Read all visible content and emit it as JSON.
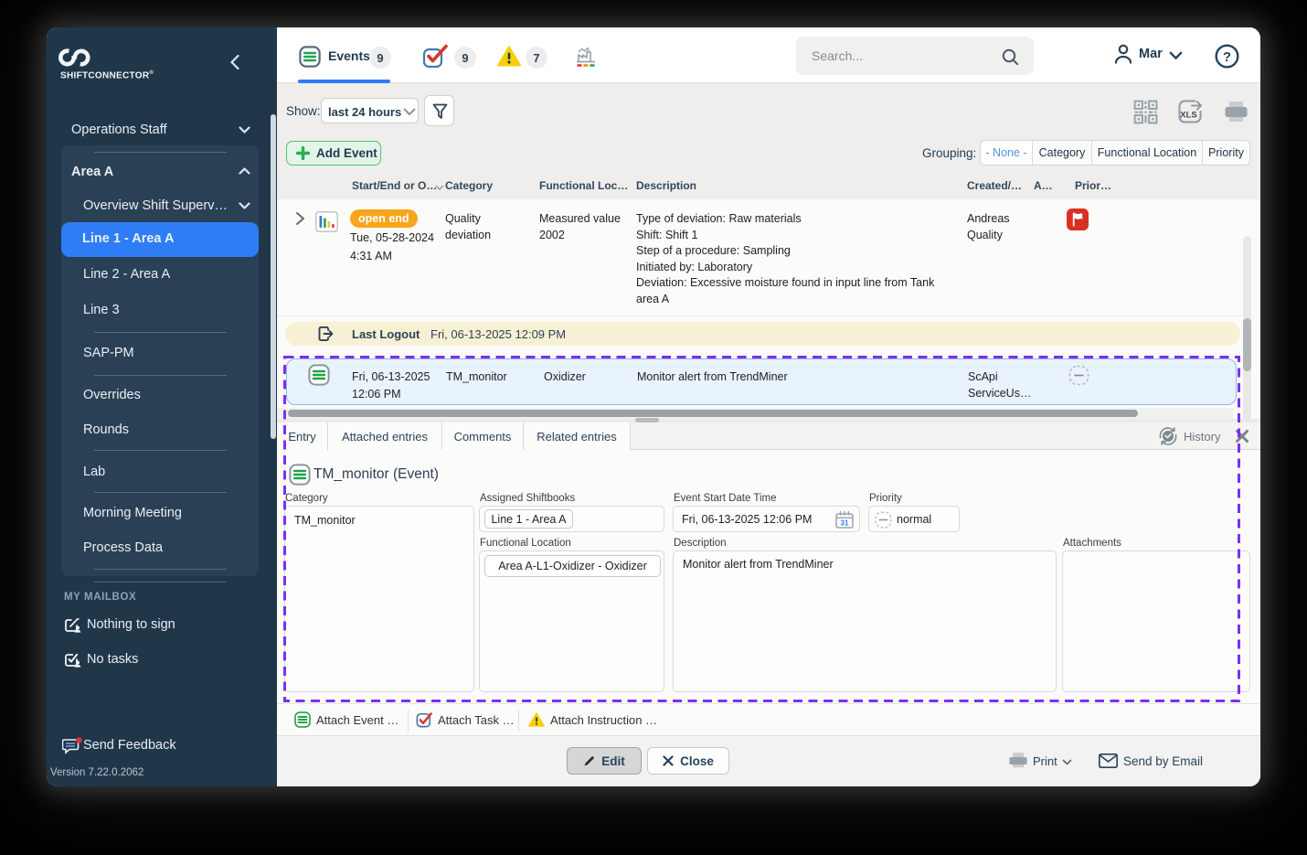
{
  "brand": {
    "name": "SHIFTCONNECTOR",
    "registered": "®",
    "version": "Version 7.22.0.2062"
  },
  "sidebar": {
    "top_item": "Operations Staff",
    "group_label": "Area A",
    "group_items": [
      "Overview Shift Superv…",
      "Line 1 - Area A",
      "Line 2 - Area A",
      "Line 3",
      "SAP-PM",
      "Overrides",
      "Rounds",
      "Lab",
      "Morning Meeting",
      "Process Data"
    ],
    "mailbox_heading": "MY MAILBOX",
    "mailbox_items": [
      "Nothing to sign",
      "No tasks"
    ],
    "feedback_label": "Send Feedback"
  },
  "topbar": {
    "events_tab": "Events",
    "events_badge": "9",
    "tasks_badge": "9",
    "warnings_badge": "7",
    "search_placeholder": "Search...",
    "user_name": "Mar"
  },
  "toolbar": {
    "show_label": "Show:",
    "show_value": "last 24 hours",
    "add_event": "Add Event",
    "grouping_label": "Grouping:",
    "grouping_none": "- None -",
    "grouping_category": "Category",
    "grouping_functional_location": "Functional Location",
    "grouping_priority": "Priority"
  },
  "table": {
    "col_start": "Start/End or O…",
    "col_category": "Category",
    "col_functional_location": "Functional Loc…",
    "col_description": "Description",
    "col_created": "Created/…",
    "col_a": "A…",
    "col_priority": "Prior…"
  },
  "row_event": {
    "status": "open end",
    "date": "Tue, 05-28-2024",
    "time": "4:31 AM",
    "category": "Quality deviation",
    "functional_location": "Measured value 2002",
    "description": "Type of deviation: Raw materials\nShift: Shift 1\nStep of a procedure: Sampling\nInitiated by: Laboratory\nDeviation: Excessive moisture found in input line from Tank area A",
    "created_by": "Andreas Quality"
  },
  "row_logout": {
    "label": "Last Logout",
    "value": "Fri, 06-13-2025 12:09 PM"
  },
  "row_selected": {
    "date": "Fri, 06-13-2025",
    "time": "12:06 PM",
    "category": "TM_monitor",
    "functional_location": "Oxidizer",
    "description": "Monitor alert from TrendMiner",
    "created_by": "ScApi\nServiceUs…"
  },
  "detail": {
    "tab_entry": "Entry",
    "tab_attached": "Attached entries",
    "tab_comments": "Comments",
    "tab_related": "Related entries",
    "history": "History",
    "title": "TM_monitor (Event)",
    "category_label": "Category",
    "category_value": "TM_monitor",
    "shiftbooks_label": "Assigned Shiftbooks",
    "shiftbooks_value": "Line 1 - Area A",
    "start_label": "Event Start Date Time",
    "start_value": "Fri, 06-13-2025 12:06 PM",
    "calendar_day": "31",
    "priority_label": "Priority",
    "priority_value": "normal",
    "functional_location_label": "Functional Location",
    "functional_location_value": "Area A-L1-Oxidizer - Oxidizer",
    "description_label": "Description",
    "description_value": "Monitor alert from TrendMiner",
    "attachments_label": "Attachments",
    "attach_event": "Attach Event …",
    "attach_task": "Attach Task …",
    "attach_instruction": "Attach Instruction …",
    "edit": "Edit",
    "close": "Close",
    "print": "Print",
    "send_by_email": "Send by Email"
  }
}
